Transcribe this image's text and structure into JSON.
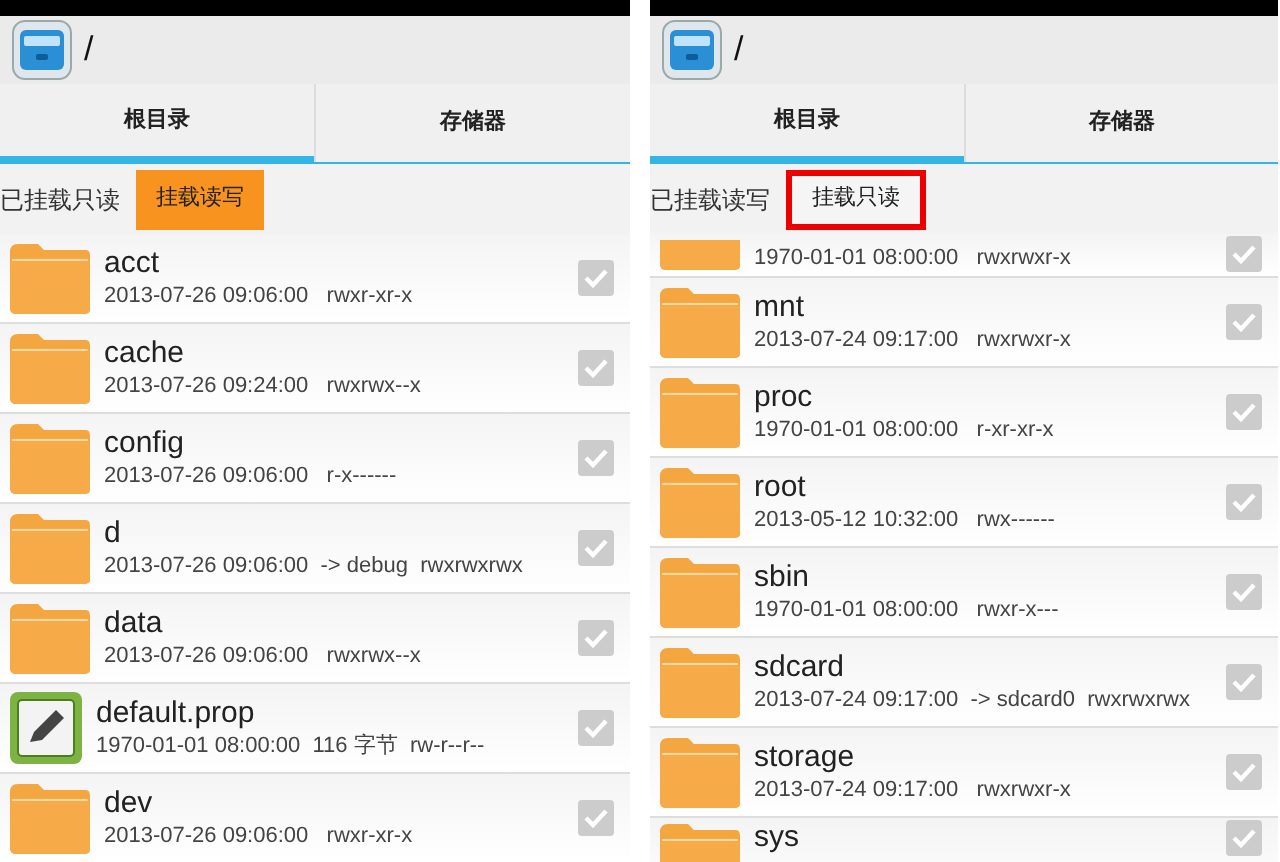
{
  "panels": [
    {
      "path": "/",
      "tabs": [
        {
          "label": "根目录",
          "selected": true
        },
        {
          "label": "存储器",
          "selected": false
        }
      ],
      "mount": {
        "status": "已挂载只读",
        "button": "挂载读写",
        "kind": "filled"
      },
      "files": [
        {
          "kind": "folder",
          "name": "acct",
          "meta": "2013-07-26 09:06:00   rwxr-xr-x",
          "checked": false
        },
        {
          "kind": "folder",
          "name": "cache",
          "meta": "2013-07-26 09:24:00   rwxrwx--x",
          "checked": false
        },
        {
          "kind": "folder",
          "name": "config",
          "meta": "2013-07-26 09:06:00   r-x------",
          "checked": false
        },
        {
          "kind": "folder",
          "name": "d",
          "meta": "2013-07-26 09:06:00  -> debug  rwxrwxrwx",
          "checked": false
        },
        {
          "kind": "folder",
          "name": "data",
          "meta": "2013-07-26 09:06:00   rwxrwx--x",
          "checked": false
        },
        {
          "kind": "file",
          "name": "default.prop",
          "meta": "1970-01-01 08:00:00  116 字节  rw-r--r--",
          "checked": false
        },
        {
          "kind": "folder",
          "name": "dev",
          "meta": "2013-07-26 09:06:00   rwxr-xr-x",
          "checked": false
        }
      ]
    },
    {
      "path": "/",
      "tabs": [
        {
          "label": "根目录",
          "selected": true
        },
        {
          "label": "存储器",
          "selected": false
        }
      ],
      "mount": {
        "status": "已挂载读写",
        "button": "挂载只读",
        "kind": "framed"
      },
      "files": [
        {
          "kind": "folder",
          "meta": "1970-01-01 08:00:00   rwxrwxr-x",
          "checked": false
        },
        {
          "kind": "folder",
          "name": "mnt",
          "meta": "2013-07-24 09:17:00   rwxrwxr-x",
          "checked": false
        },
        {
          "kind": "folder",
          "name": "proc",
          "meta": "1970-01-01 08:00:00   r-xr-xr-x",
          "checked": false
        },
        {
          "kind": "folder",
          "name": "root",
          "meta": "2013-05-12 10:32:00   rwx------",
          "checked": false
        },
        {
          "kind": "folder",
          "name": "sbin",
          "meta": "1970-01-01 08:00:00   rwxr-x---",
          "checked": false
        },
        {
          "kind": "folder",
          "name": "sdcard",
          "meta": "2013-07-24 09:17:00  -> sdcard0  rwxrwxrwx",
          "checked": false
        },
        {
          "kind": "folder",
          "name": "storage",
          "meta": "2013-07-24 09:17:00   rwxrwxr-x",
          "checked": false
        },
        {
          "kind": "folder",
          "name": "sys",
          "checked": false
        }
      ]
    }
  ]
}
